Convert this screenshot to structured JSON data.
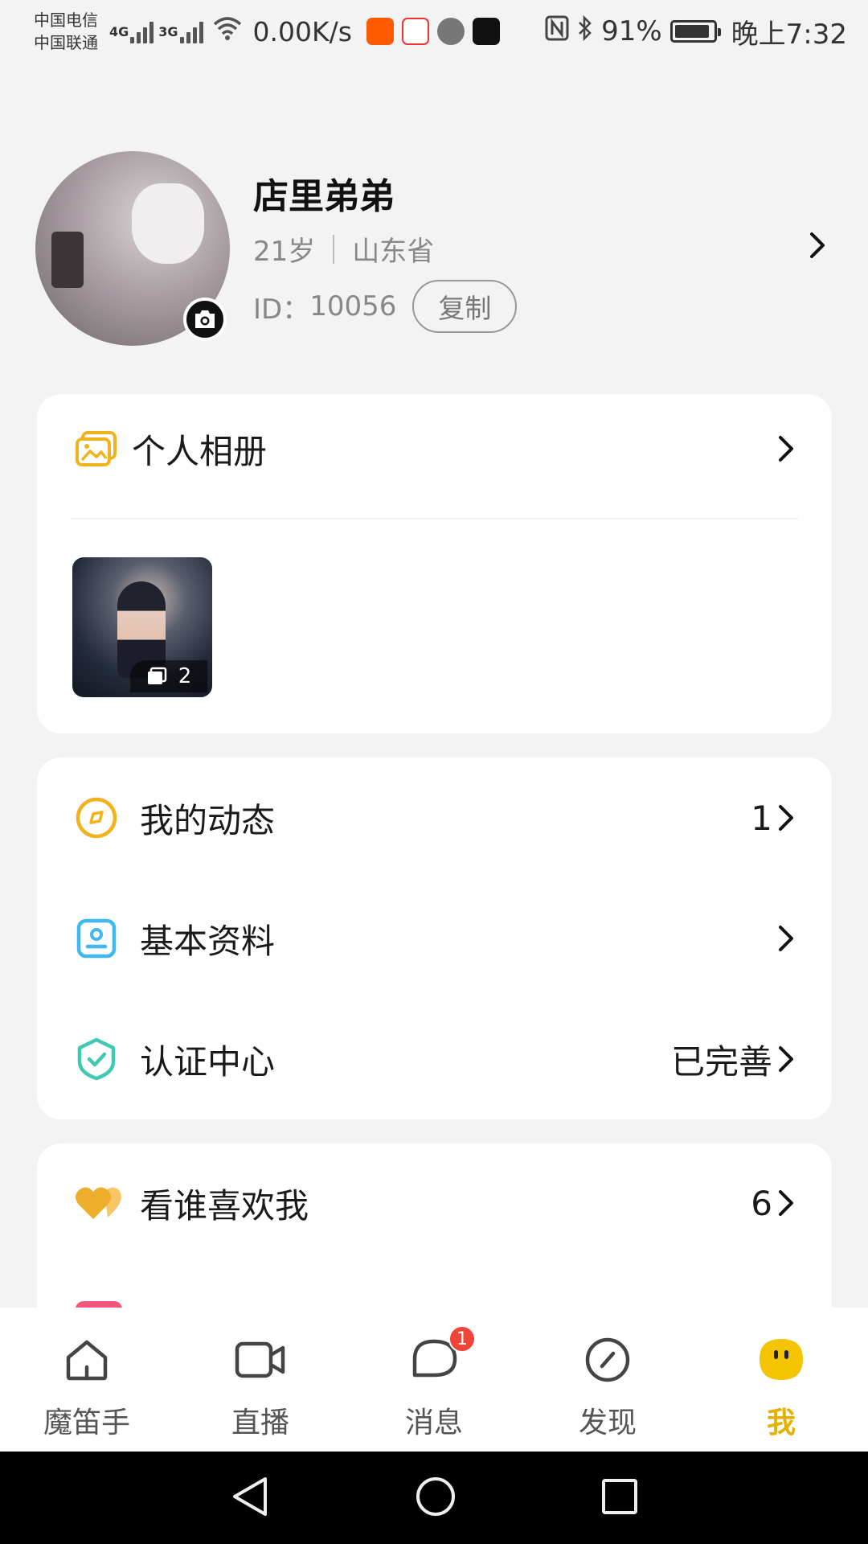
{
  "status_bar": {
    "carrier1": "中国电信",
    "carrier2": "中国联通",
    "net1": "4G",
    "net2": "3G",
    "speed": "0.00K/s",
    "battery": "91%",
    "time": "晚上7:32",
    "app_icons": [
      "taobao-icon",
      "dewu-icon",
      "audio-app-icon",
      "tiktok-icon"
    ],
    "battery_level": 0.91
  },
  "profile": {
    "name": "店里弟弟",
    "age": "21岁",
    "province": "山东省",
    "id_label": "ID：",
    "id_value": "10056",
    "copy_label": "复制"
  },
  "album": {
    "title": "个人相册",
    "photo_count": "2"
  },
  "menu1": {
    "items": [
      {
        "label": "我的动态",
        "value": "1",
        "icon": "compass-icon",
        "color": "#f2b21b"
      },
      {
        "label": "基本资料",
        "value": "",
        "icon": "id-card-icon",
        "color": "#3db8f0"
      },
      {
        "label": "认证中心",
        "value": "已完善",
        "icon": "shield-check-icon",
        "color": "#3ec9b0"
      }
    ]
  },
  "menu2": {
    "items": [
      {
        "label": "看谁喜欢我",
        "value": "6",
        "icon": "hearts-icon",
        "color": "#f0b43a"
      }
    ]
  },
  "bottom_nav": {
    "tabs": [
      {
        "label": "魔笛手",
        "icon": "home-icon"
      },
      {
        "label": "直播",
        "icon": "video-camera-icon"
      },
      {
        "label": "消息",
        "icon": "message-icon",
        "badge": "1"
      },
      {
        "label": "发现",
        "icon": "discover-icon"
      },
      {
        "label": "我",
        "icon": "me-face-icon",
        "active": true
      }
    ]
  },
  "colors": {
    "accent": "#f5c400",
    "background": "#f3f3f3",
    "badge": "#f04438"
  }
}
